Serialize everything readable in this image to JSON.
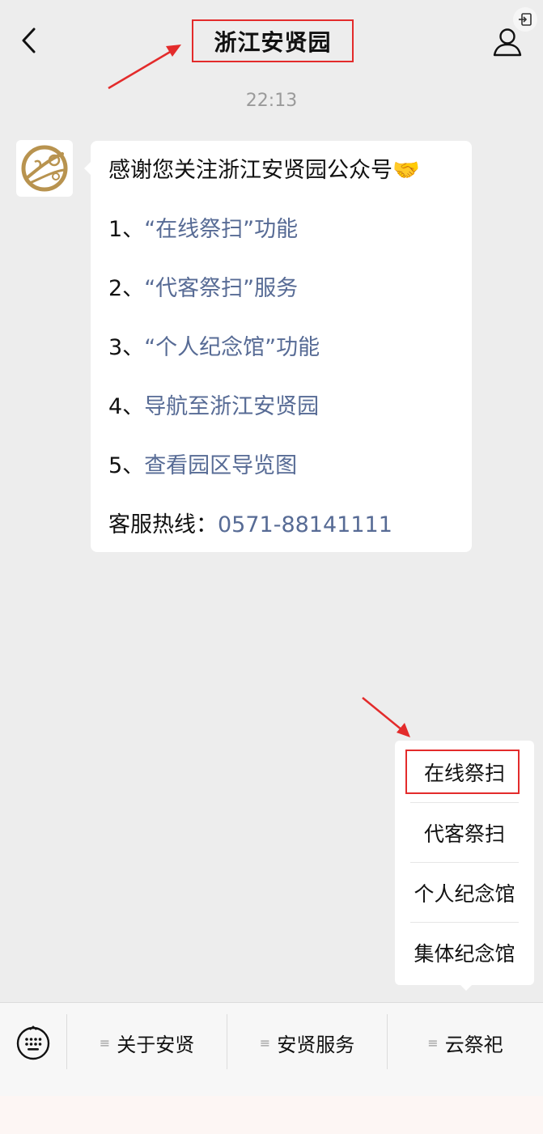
{
  "header": {
    "title": "浙江安贤园"
  },
  "chat": {
    "timestamp": "22:13",
    "message": {
      "line1": "感谢您关注浙江安贤园公众号🤝",
      "item1_prefix": "1、",
      "item1_link": "“在线祭扫”",
      "item1_suffix": "功能",
      "item2_prefix": "2、",
      "item2_link": "“代客祭扫”服务",
      "item3_prefix": "3、",
      "item3_link": "“个人纪念馆”",
      "item3_suffix": "功能",
      "item4_prefix": "4、",
      "item4_link": "导航至浙江安贤园",
      "item5_prefix": "5、",
      "item5_link": "查看园区导览图",
      "hotline_label": "客服热线：",
      "hotline_number": "0571-88141111"
    }
  },
  "popup_menu": {
    "items": [
      "在线祭扫",
      "代客祭扫",
      "个人纪念馆",
      "集体纪念馆"
    ]
  },
  "bottom_bar": {
    "tabs": [
      "关于安贤",
      "安贤服务",
      "云祭祀"
    ]
  },
  "colors": {
    "accent_link": "#576b95",
    "highlight_red": "#e32b2b",
    "avatar_gold": "#b8934f"
  },
  "icons": {
    "back": "chevron-left-icon",
    "profile": "person-icon",
    "exit": "exit-icon",
    "keyboard": "keyboard-icon",
    "menu": "hamburger-icon"
  }
}
